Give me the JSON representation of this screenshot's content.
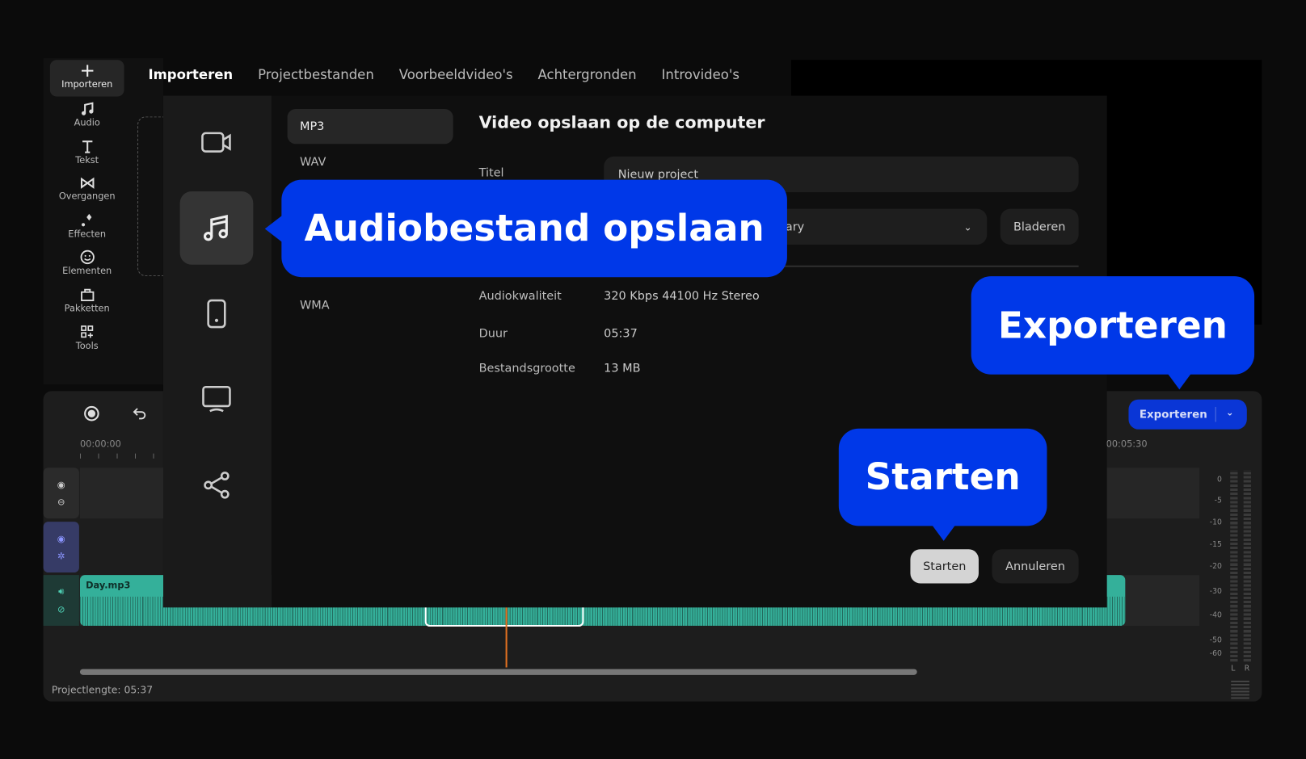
{
  "sidebar": {
    "items": [
      {
        "label": "Importeren",
        "icon": "plus-icon"
      },
      {
        "label": "Audio",
        "icon": "music-icon"
      },
      {
        "label": "Tekst",
        "icon": "text-icon"
      },
      {
        "label": "Overgangen",
        "icon": "transition-icon"
      },
      {
        "label": "Effecten",
        "icon": "sparkle-icon"
      },
      {
        "label": "Elementen",
        "icon": "smiley-icon"
      },
      {
        "label": "Pakketten",
        "icon": "package-icon"
      },
      {
        "label": "Tools",
        "icon": "tools-icon"
      }
    ]
  },
  "tabs": [
    "Importeren",
    "Projectbestanden",
    "Voorbeeldvideo's",
    "Achtergronden",
    "Introvideo's"
  ],
  "dialog": {
    "title": "Video opslaan op de computer",
    "formats": [
      "MP3",
      "WAV",
      "WMA"
    ],
    "title_label": "Titel",
    "title_value": "Nieuw project",
    "folder_value_partial": "ary",
    "browse": "Bladeren",
    "quality_label": "Audiokwaliteit",
    "quality_value": "320 Kbps 44100 Hz Stereo",
    "duration_label": "Duur",
    "duration_value": "05:37",
    "size_label": "Bestandsgrootte",
    "size_value": "13 MB",
    "start": "Starten",
    "cancel": "Annuleren"
  },
  "callouts": {
    "audio": "Audiobestand opslaan",
    "export": "Exporteren",
    "start": "Starten"
  },
  "timeline": {
    "export_button": "Exporteren",
    "time_start": "00:00:00",
    "time_end": "00:05:30",
    "clip_name": "Day.mp3",
    "project_length": "Projectlengte: 05:37",
    "meter_labels": [
      "0",
      "-5",
      "-10",
      "-15",
      "-20",
      "-30",
      "-40",
      "-50",
      "-60"
    ],
    "meter_channels": [
      "L",
      "R"
    ]
  },
  "colors": {
    "accent": "#0038e8",
    "clip": "#34b09a",
    "playhead": "#e07020"
  }
}
